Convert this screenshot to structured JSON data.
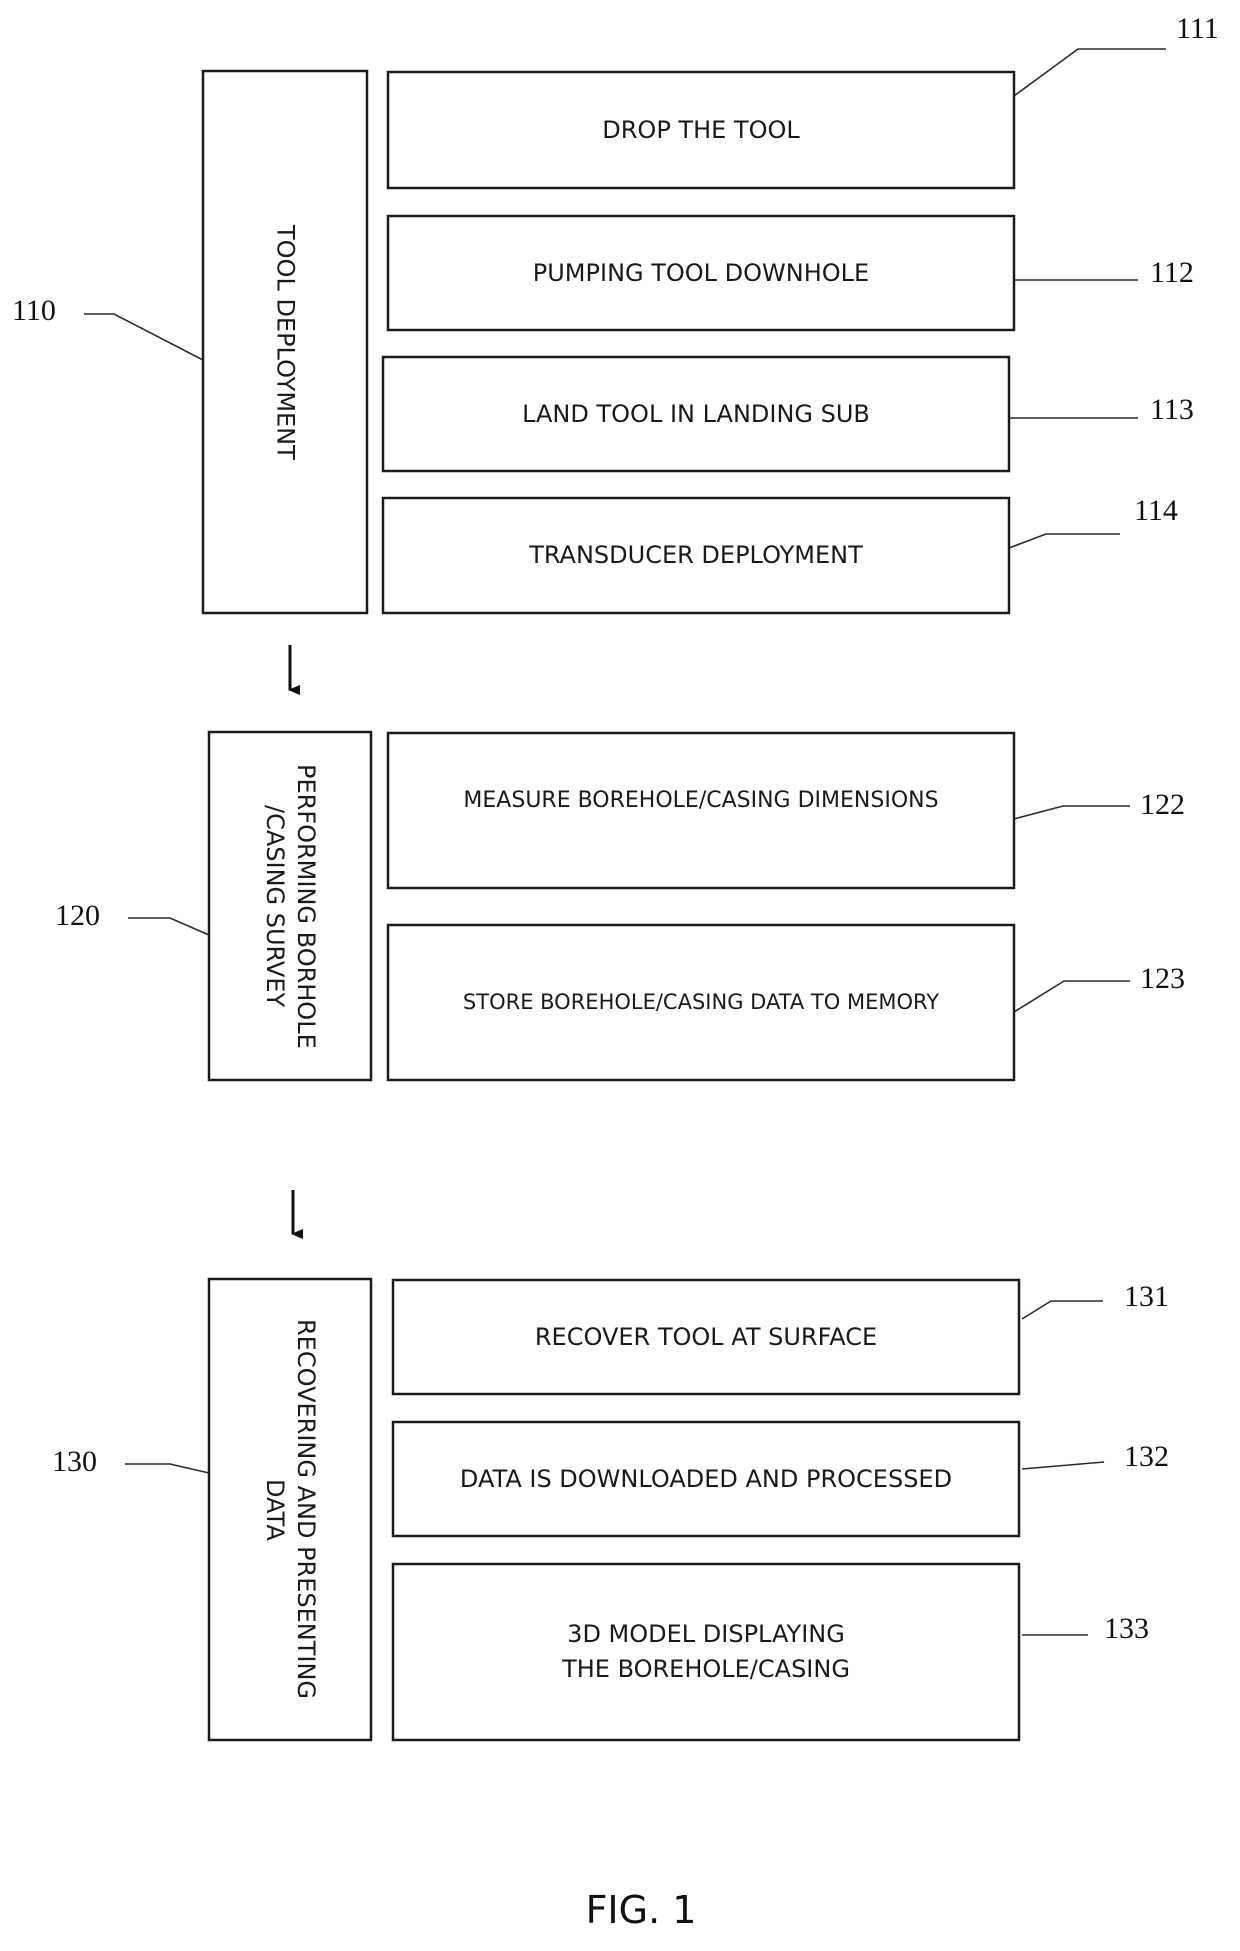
{
  "figure": {
    "caption": "FIG. 1",
    "stages": [
      {
        "ref": "110",
        "label": "TOOL DEPLOYMENT",
        "steps": [
          {
            "ref": "111",
            "label": "DROP THE TOOL"
          },
          {
            "ref": "112",
            "label": "PUMPING TOOL DOWNHOLE"
          },
          {
            "ref": "113",
            "label": "LAND TOOL IN LANDING SUB"
          },
          {
            "ref": "114",
            "label": "TRANSDUCER DEPLOYMENT"
          }
        ]
      },
      {
        "ref": "120",
        "label": "PERFORMING BORHOLE /CASING SURVEY",
        "steps": [
          {
            "ref": "122",
            "label": "MEASURE BOREHOLE/CASING DIMENSIONS"
          },
          {
            "ref": "123",
            "label": "STORE BOREHOLE/CASING DATA TO MEMORY"
          }
        ]
      },
      {
        "ref": "130",
        "label": "RECOVERING AND PRESENTING DATA",
        "steps": [
          {
            "ref": "131",
            "label": "RECOVER TOOL AT SURFACE"
          },
          {
            "ref": "132",
            "label": "DATA IS DOWNLOADED AND PROCESSED"
          },
          {
            "ref": "133",
            "label": "3D MODEL DISPLAYING THE BOREHOLE/CASING"
          }
        ]
      }
    ]
  }
}
